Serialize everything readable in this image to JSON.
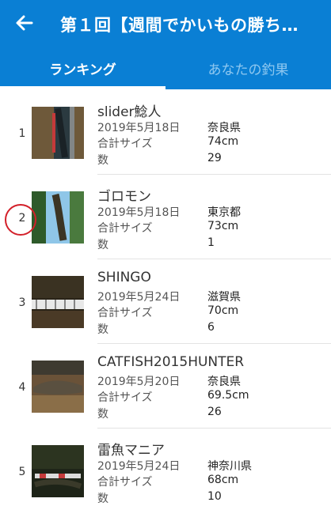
{
  "header": {
    "title": "第１回【週間でかいもの勝ち…",
    "tabs": [
      {
        "label": "ランキング",
        "active": true
      },
      {
        "label": "あなたの釣果",
        "active": false
      }
    ]
  },
  "list": {
    "size_label": "合計サイズ",
    "count_label": "数",
    "entries": [
      {
        "rank": "1",
        "name": "slider鯰人",
        "date": "2019年5月18日",
        "pref": "奈良県",
        "size": "74cm",
        "count": "29",
        "thumb_icon": "fish-photo-icon"
      },
      {
        "rank": "2",
        "name": "ゴロモン",
        "date": "2019年5月18日",
        "pref": "東京都",
        "size": "73cm",
        "count": "1",
        "thumb_icon": "fish-photo-icon"
      },
      {
        "rank": "3",
        "name": "SHINGO",
        "date": "2019年5月24日",
        "pref": "滋賀県",
        "size": "70cm",
        "count": "6",
        "thumb_icon": "fish-photo-icon"
      },
      {
        "rank": "4",
        "name": "CATFISH2015HUNTER",
        "date": "2019年5月20日",
        "pref": "奈良県",
        "size": "69.5cm",
        "count": "26",
        "thumb_icon": "fish-photo-icon"
      },
      {
        "rank": "5",
        "name": "雷魚マニア",
        "date": "2019年5月24日",
        "pref": "神奈川県",
        "size": "68cm",
        "count": "10",
        "thumb_icon": "fish-photo-icon"
      }
    ]
  },
  "colors": {
    "accent": "#0a7fd4",
    "highlight_circle": "#d3202a"
  }
}
